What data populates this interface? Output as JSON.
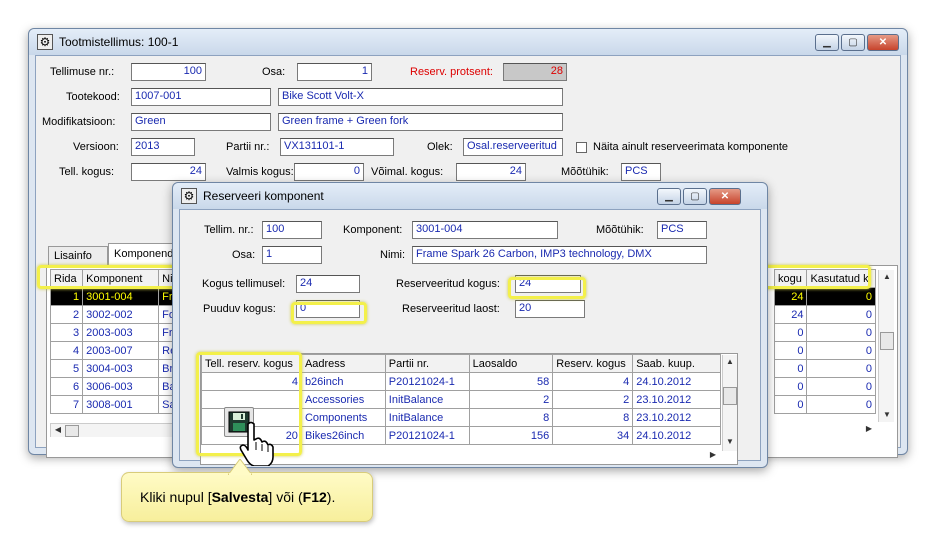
{
  "main": {
    "title": "Tootmistellimus: 100-1",
    "labels": {
      "order_no": "Tellimuse nr.:",
      "part": "Osa:",
      "reserve_pct": "Reserv. protsent:",
      "product_code": "Tootekood:",
      "modification": "Modifikatsioon:",
      "version": "Versioon:",
      "batch_no": "Partii nr.:",
      "status": "Olek:",
      "show_unreserved": "Näita ainult reserveerimata komponente",
      "order_qty": "Tell. kogus:",
      "finished_qty": "Valmis kogus:",
      "remaining_qty": "Võimal. kogus:",
      "unit": "Mõõtühik:"
    },
    "values": {
      "order_no": "100",
      "part": "1",
      "reserve_pct": "28",
      "product_code": "1007-001",
      "product_name": "Bike Scott Volt-X",
      "modification": "Green",
      "modification_desc": "Green frame + Green fork",
      "version": "2013",
      "batch_no": "VX131101-1",
      "status": "Osal.reserveeritud",
      "order_qty": "24",
      "finished_qty": "0",
      "remaining_qty": "24",
      "unit": "PCS"
    },
    "tabs": [
      "Lisainfo",
      "Komponendid"
    ],
    "grid": {
      "headers": [
        "Rida",
        "Komponent",
        "Ni"
      ],
      "right_headers": [
        "kogu",
        "Kasutatud k"
      ],
      "rows": [
        {
          "rida": "1",
          "komponent": "3001-004",
          "ni": "Fr",
          "kogus": "24",
          "kasutatud": "0"
        },
        {
          "rida": "2",
          "komponent": "3002-002",
          "ni": "Fo",
          "kogus": "24",
          "kasutatud": "0"
        },
        {
          "rida": "3",
          "komponent": "2003-003",
          "ni": "Fr",
          "kogus": "0",
          "kasutatud": "0"
        },
        {
          "rida": "4",
          "komponent": "2003-007",
          "ni": "Re",
          "kogus": "0",
          "kasutatud": "0"
        },
        {
          "rida": "5",
          "komponent": "3004-003",
          "ni": "Br",
          "kogus": "0",
          "kasutatud": "0"
        },
        {
          "rida": "6",
          "komponent": "3006-003",
          "ni": "Ba",
          "kogus": "0",
          "kasutatud": "0"
        },
        {
          "rida": "7",
          "komponent": "3008-001",
          "ni": "Sa",
          "kogus": "0",
          "kasutatud": "0"
        }
      ]
    }
  },
  "dialog": {
    "title": "Reserveeri komponent",
    "labels": {
      "order_no": "Tellim. nr.:",
      "component": "Komponent:",
      "unit": "Mõõtühik:",
      "part": "Osa:",
      "name": "Nimi:",
      "qty_ordered": "Kogus tellimusel:",
      "reserved_qty": "Reserveeritud kogus:",
      "missing_qty": "Puuduv kogus:",
      "reserved_from_stock": "Reserveeritud laost:"
    },
    "values": {
      "order_no": "100",
      "component": "3001-004",
      "unit": "PCS",
      "part": "1",
      "name": "Frame Spark 26 Carbon, IMP3 technology, DMX",
      "qty_ordered": "24",
      "reserved_qty": "24",
      "missing_qty": "0",
      "reserved_from_stock": "20"
    },
    "grid": {
      "headers": [
        "Tell. reserv. kogus",
        "Aadress",
        "Partii nr.",
        "Laosaldo",
        "Reserv. kogus",
        "Saab. kuup."
      ],
      "rows": [
        {
          "tell": "4",
          "aadress": "b26inch",
          "partii": "P20121024-1",
          "saldo": "58",
          "reserv": "4",
          "kuup": "24.10.2012"
        },
        {
          "tell": "",
          "aadress": "Accessories",
          "partii": "InitBalance",
          "saldo": "2",
          "reserv": "2",
          "kuup": "23.10.2012"
        },
        {
          "tell": "",
          "aadress": "Components",
          "partii": "InitBalance",
          "saldo": "8",
          "reserv": "8",
          "kuup": "23.10.2012"
        },
        {
          "tell": "20",
          "aadress": "Bikes26inch",
          "partii": "P20121024-1",
          "saldo": "156",
          "reserv": "34",
          "kuup": "24.10.2012"
        }
      ]
    }
  },
  "callout": {
    "prefix": "Kliki nupul [",
    "bold1": "Salvesta",
    "middle": "] või (",
    "bold2": "F12",
    "suffix": ")."
  },
  "colors": {
    "highlight": "#f3f04a",
    "field_text": "#1a2ab0",
    "selected_row_bg": "#000000",
    "selected_row_text": "#ffff00",
    "accent_red": "#dd0000"
  },
  "icons": {
    "window": "gear-icon",
    "save": "floppy-disk-icon",
    "cursor": "hand-pointer-icon"
  }
}
